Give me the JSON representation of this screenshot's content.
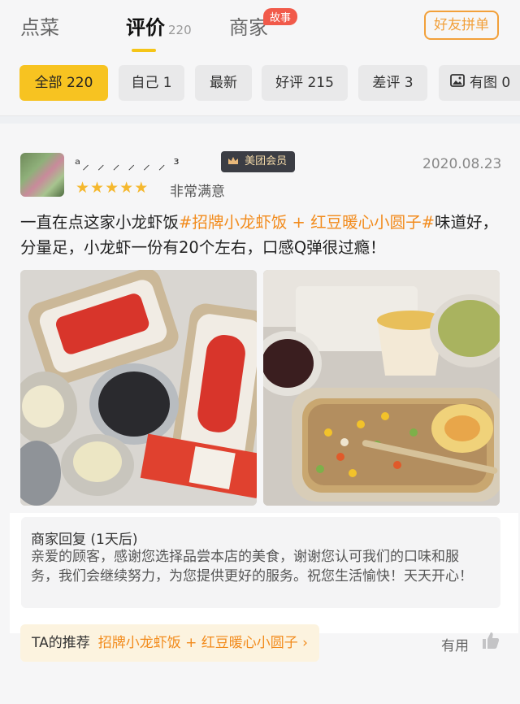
{
  "tabs": [
    {
      "label": "点菜"
    },
    {
      "label": "评价",
      "count": "220"
    },
    {
      "label": "商家",
      "badge": "故事"
    }
  ],
  "friend_order_button": "好友拼单",
  "filters": [
    {
      "label": "全部 220"
    },
    {
      "label": "自己 1"
    },
    {
      "label": "最新"
    },
    {
      "label": "好评 215"
    },
    {
      "label": "差评 3"
    },
    {
      "label": "有图 0"
    }
  ],
  "review": {
    "username": "ᵃ⸝ ⸝ ⸝ ⸝ ⸝ ⸝ ³",
    "vip_badge": "美团会员",
    "date": "2020.08.23",
    "stars": 5,
    "rating_text": "非常满意",
    "text_before": "一直在点这家小龙虾饭",
    "tags": "#招牌小龙虾饭 + 红豆暖心小圆子#",
    "text_after": "味道好，分量足，小龙虾一份有20个左右，口感Q弹很过瘾！",
    "reply_title": "商家回复 (1天后)",
    "reply_text": "亲爱的顾客，感谢您选择品尝本店的美食，谢谢您认可我们的口味和服务，我们会继续努力，为您提供更好的服务。祝您生活愉快！天天开心！",
    "recommend_label": "TA的推荐",
    "recommend_dishes": "招牌小龙虾饭 + 红豆暖心小圆子 ›",
    "useful_label": "有用"
  },
  "colors": {
    "accent": "#f7c321",
    "tag_orange": "#f28b1c",
    "star": "#f5b82e"
  }
}
